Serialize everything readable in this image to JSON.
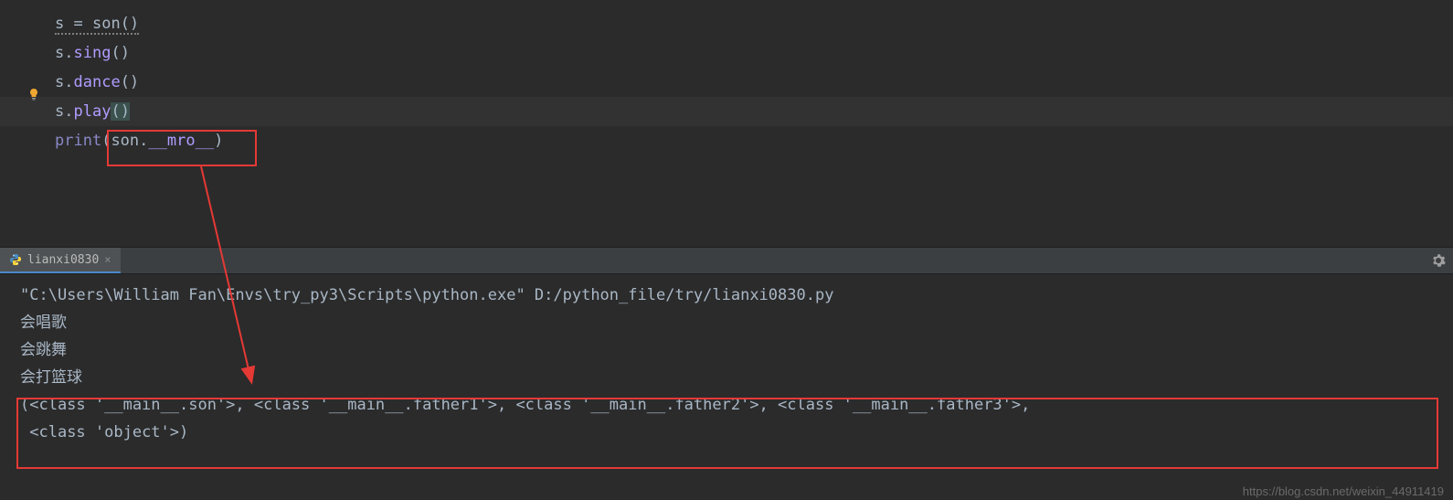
{
  "editor": {
    "line1": {
      "var": "s",
      "op": " = ",
      "fn": "son",
      "parens": "()"
    },
    "line2": {
      "var": "s",
      "dot": ".",
      "method": "sing",
      "parens": "()"
    },
    "line3": {
      "var": "s",
      "dot": ".",
      "method": "dance",
      "parens": "()"
    },
    "line4": {
      "var": "s",
      "dot": ".",
      "method": "play",
      "lp": "(",
      "rp": ")"
    },
    "line5": {
      "builtin": "print",
      "lp": "(",
      "ident": "son",
      "dot": ".",
      "dunder": "__mro__",
      "rp": ")"
    }
  },
  "tab": {
    "name": "lianxi0830"
  },
  "console": {
    "line1": "\"C:\\Users\\William Fan\\Envs\\try_py3\\Scripts\\python.exe\" D:/python_file/try/lianxi0830.py",
    "line2": "会唱歌",
    "line3": "会跳舞",
    "line4": "会打篮球",
    "line5": "(<class '__main__.son'>, <class '__main__.father1'>, <class '__main__.father2'>, <class '__main__.father3'>,",
    "line6": " <class 'object'>)"
  },
  "watermark": "https://blog.csdn.net/weixin_44911419"
}
